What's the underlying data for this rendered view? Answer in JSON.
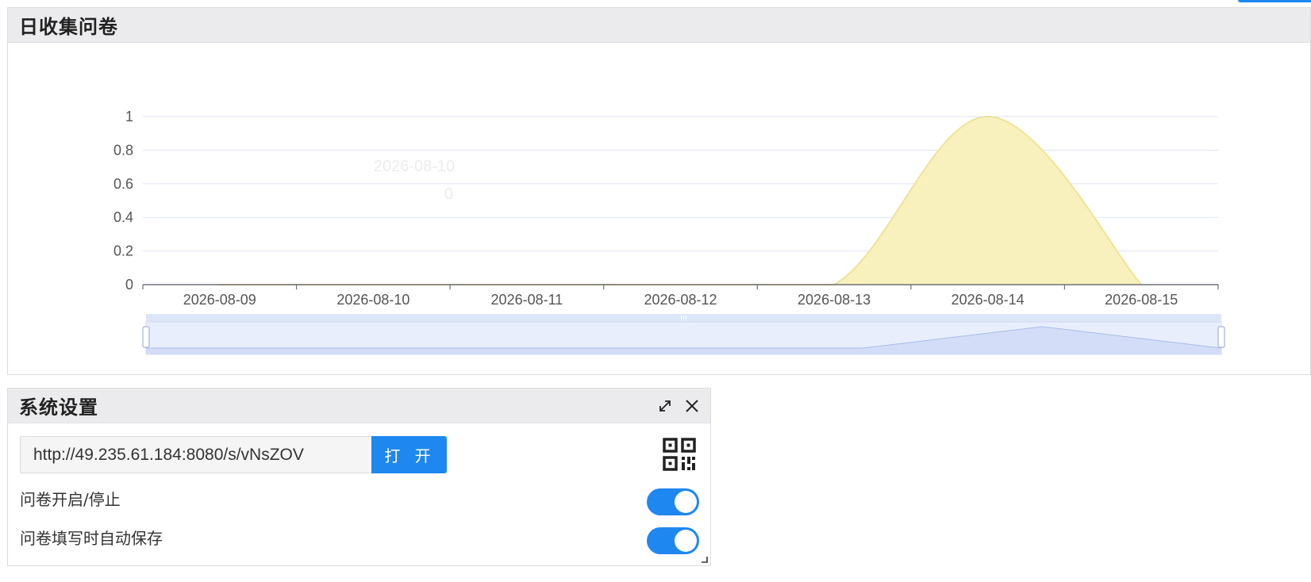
{
  "chart_panel": {
    "title": "日收集问卷"
  },
  "chart_data": {
    "type": "area",
    "title": "",
    "xlabel": "",
    "ylabel": "",
    "categories": [
      "2026-08-09",
      "2026-08-10",
      "2026-08-11",
      "2026-08-12",
      "2026-08-13",
      "2026-08-14",
      "2026-08-15"
    ],
    "values": [
      0,
      0,
      0,
      0,
      0,
      1,
      0
    ],
    "y_ticks": [
      "0",
      "0.2",
      "0.4",
      "0.6",
      "0.8",
      "1"
    ],
    "ylim": [
      0,
      1
    ],
    "smooth": true,
    "grid": true,
    "legend": "none",
    "series_color": "#f7f0b6",
    "series_stroke": "#ede39a",
    "tooltip": {
      "label": "2026-08-10",
      "value": "0"
    },
    "zoom_slider": true
  },
  "settings_panel": {
    "title": "系统设置",
    "url_value": "http://49.235.61.184:8080/s/vNsZOV",
    "open_button_label": "打 开",
    "toggle_open_stop_label": "问卷开启/停止",
    "toggle_open_stop_on": true,
    "toggle_autosave_label": "问卷填写时自动保存",
    "toggle_autosave_on": true
  },
  "icons": {
    "expand": "expand-icon",
    "close": "close-icon",
    "qr": "qr-code-icon"
  },
  "colors": {
    "accent": "#1e87f0",
    "header_bg": "#ebebee",
    "area_fill": "#f7f0b6",
    "slider_fill": "#e3ebfb"
  }
}
